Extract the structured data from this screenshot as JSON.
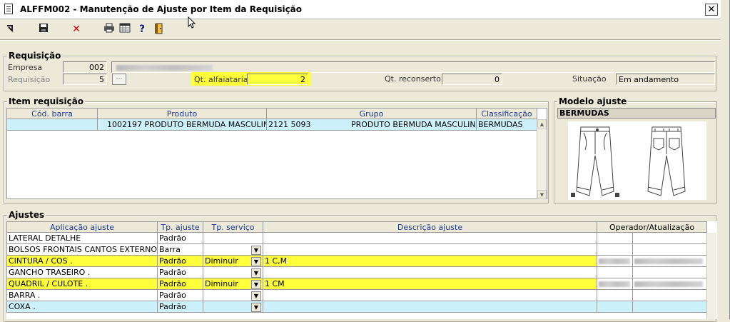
{
  "window": {
    "title": "ALFFM002 - Manutenção de Ajuste por Item da Requisição",
    "close_glyph": "✕"
  },
  "toolbar": {
    "icons": [
      "exit-icon",
      "save-icon",
      "cancel-icon",
      "print-icon",
      "calendar-icon",
      "help-icon",
      "door-icon"
    ],
    "cancel_glyph": "✕",
    "help_glyph": "?"
  },
  "requisicao": {
    "title": "Requisição",
    "empresa_label": "Empresa",
    "empresa_value": "002",
    "requisicao_label": "Requisição",
    "requisicao_value": "5",
    "qt_alfaiataria_label": "Qt. alfaiataria",
    "qt_alfaiataria_value": "2",
    "qt_reconserto_label": "Qt. reconserto",
    "qt_reconserto_value": "0",
    "situacao_label": "Situação",
    "situacao_value": "Em andamento"
  },
  "item": {
    "title": "Item requisição",
    "columns": [
      "Cód. barra",
      "Produto",
      "Grupo",
      "Classificação"
    ],
    "rows": [
      {
        "cod_barra": "",
        "produto_cod": "1002197",
        "produto_desc": "PRODUTO BERMUDA MASCULINA P",
        "grupo_cod": "2121 5093",
        "grupo_desc": "PRODUTO BERMUDA MASCULINA",
        "classificacao": "BERMUDAS"
      }
    ]
  },
  "modelo": {
    "title": "Modelo ajuste",
    "name": "BERMUDAS"
  },
  "ajustes": {
    "title": "Ajustes",
    "columns": [
      "Aplicação ajuste",
      "Tp. ajuste",
      "Tp. serviço",
      "Descrição ajuste",
      "Operador/Atualização"
    ],
    "rows": [
      {
        "aplicacao": "LATERAL DETALHE",
        "tp_ajuste": "Padrão",
        "tp_servico": "",
        "descricao": "",
        "highlight": false
      },
      {
        "aplicacao": "BOLSOS FRONTAIS CANTOS EXTERNOS",
        "tp_ajuste": "Barra",
        "tp_servico": "",
        "descricao": "",
        "highlight": false
      },
      {
        "aplicacao": "CINTURA / COS .",
        "tp_ajuste": "Padrão",
        "tp_servico": "Diminuir",
        "descricao": "1 C,M",
        "highlight": true
      },
      {
        "aplicacao": "GANCHO TRASEIRO .",
        "tp_ajuste": "Padrão",
        "tp_servico": "",
        "descricao": "",
        "highlight": false
      },
      {
        "aplicacao": "QUADRIL / CULOTE .",
        "tp_ajuste": "Padrão",
        "tp_servico": "Diminuir",
        "descricao": "1 CM",
        "highlight": true
      },
      {
        "aplicacao": "BARRA .",
        "tp_ajuste": "Padrão",
        "tp_servico": "",
        "descricao": "",
        "highlight": false
      },
      {
        "aplicacao": "COXA .",
        "tp_ajuste": "Padrão",
        "tp_servico": "",
        "descricao": "",
        "highlight": false
      }
    ]
  }
}
